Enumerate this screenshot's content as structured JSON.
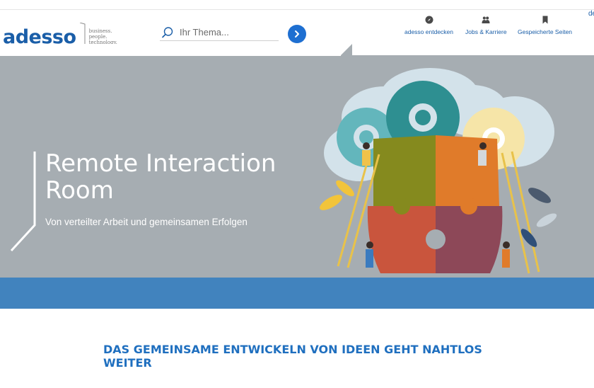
{
  "brand": {
    "logo_text": "adesso",
    "tagline": [
      "business.",
      "people.",
      "technology."
    ]
  },
  "search": {
    "placeholder": "Ihr Thema..."
  },
  "nav": {
    "items": [
      {
        "label": "adesso entdecken",
        "icon": "compass-icon"
      },
      {
        "label": "Jobs & Karriere",
        "icon": "people-icon"
      },
      {
        "label": "Gespeicherte Seiten",
        "icon": "bookmark-icon"
      }
    ],
    "language": "de"
  },
  "hero": {
    "title": "Remote Interaction Room",
    "subtitle": "Von verteilter Arbeit und gemeinsamen Erfolgen",
    "illustration": "gears-and-puzzle-illustration"
  },
  "content": {
    "heading": "DAS GEMEINSAME ENTWICKELN VON IDEEN GEHT NAHTLOS WEITER"
  },
  "colors": {
    "brand_blue": "#1a5ea8",
    "accent_blue": "#1e6fd1",
    "hero_gray": "#a6adb2",
    "band_blue": "#4183be",
    "heading_blue": "#1f6fbf"
  }
}
